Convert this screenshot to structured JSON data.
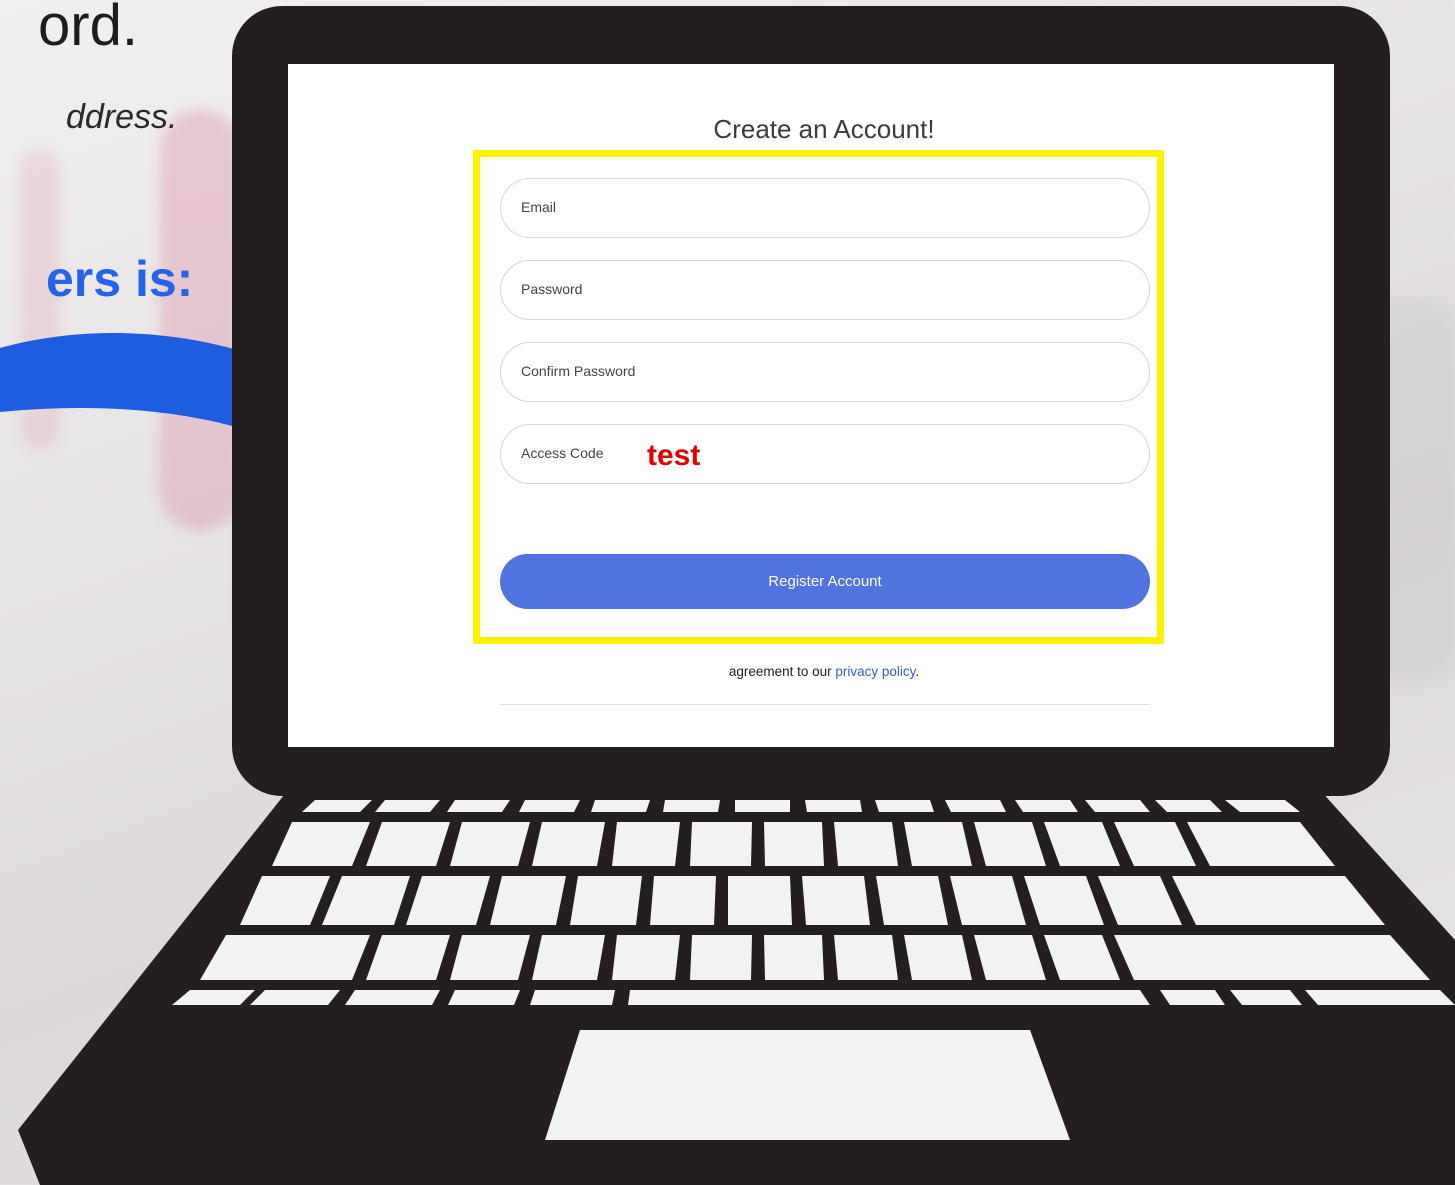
{
  "slide": {
    "headline_fragment": "ord.",
    "subline_fragment": "ddress.",
    "callout_fragment": "ers is:",
    "colors": {
      "callout": "#2563eb",
      "highlight": "#fff200",
      "laptop": "#231f20",
      "arrow": "#1f5de0"
    }
  },
  "form": {
    "title": "Create an Account!",
    "fields": [
      {
        "label": "Email",
        "value": ""
      },
      {
        "label": "Password",
        "value": ""
      },
      {
        "label": "Confirm Password",
        "value": ""
      },
      {
        "label": "Access Code",
        "value": "test"
      }
    ],
    "register_label": "Register Account",
    "legal_prefix": "agreement to our ",
    "legal_link": "privacy policy",
    "legal_suffix": ".",
    "colors": {
      "button": "#4f74e0",
      "access_code_value": "#e00000",
      "link": "#3a5bd0"
    }
  }
}
